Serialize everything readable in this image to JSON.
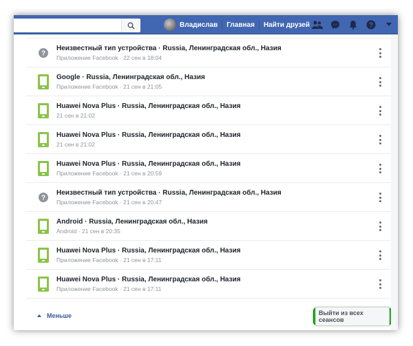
{
  "header": {
    "search": {
      "placeholder": "",
      "value": ""
    },
    "profile_name": "Владислав",
    "nav_home": "Главная",
    "nav_find_friends": "Найти друзей",
    "icons": [
      "friend-requests-icon",
      "messenger-icon",
      "notifications-icon",
      "help-icon",
      "dropdown-icon"
    ]
  },
  "sessions": [
    {
      "device": "unknown",
      "title": "Неизвестный тип устройства · Russia, Ленинградская обл., Назия",
      "sub": "Приложение Facebook · 22 сен в 18:04"
    },
    {
      "device": "phone",
      "title": "Google · Russia, Ленинградская обл., Назия",
      "sub": "Приложение Facebook · 21 сен в 21:05"
    },
    {
      "device": "phone",
      "title": "Huawei Nova Plus · Russia, Ленинградская обл., Назия",
      "sub": "21 сен в 21:02"
    },
    {
      "device": "phone",
      "title": "Huawei Nova Plus · Russia, Ленинградская обл., Назия",
      "sub": "21 сен в 21:02"
    },
    {
      "device": "phone",
      "title": "Huawei Nova Plus · Russia, Ленинградская обл., Назия",
      "sub": "Приложение Facebook · 21 сен в 20:59"
    },
    {
      "device": "unknown",
      "title": "Неизвестный тип устройства · Russia, Ленинградская обл., Назия",
      "sub": "Приложение Facebook · 21 сен в 20:47"
    },
    {
      "device": "phone",
      "title": "Android · Russia, Ленинградская обл., Назия",
      "sub": "Android · 21 сен в 20:35"
    },
    {
      "device": "phone",
      "title": "Huawei Nova Plus · Russia, Ленинградская обл., Назия",
      "sub": "Приложение Facebook · 21 сен в 17:11"
    },
    {
      "device": "phone",
      "title": "Huawei Nova Plus · Russia, Ленинградская обл., Назия",
      "sub": "Приложение Facebook · 21 сен в 17:11"
    }
  ],
  "footer": {
    "less_label": "Меньше",
    "logout_all_label": "Выйти из всех сеансов"
  },
  "colors": {
    "brand": "#4267b2",
    "highlight": "#1db11d",
    "phone_icon": "#8bc34a",
    "unknown_icon": "#90949c"
  }
}
